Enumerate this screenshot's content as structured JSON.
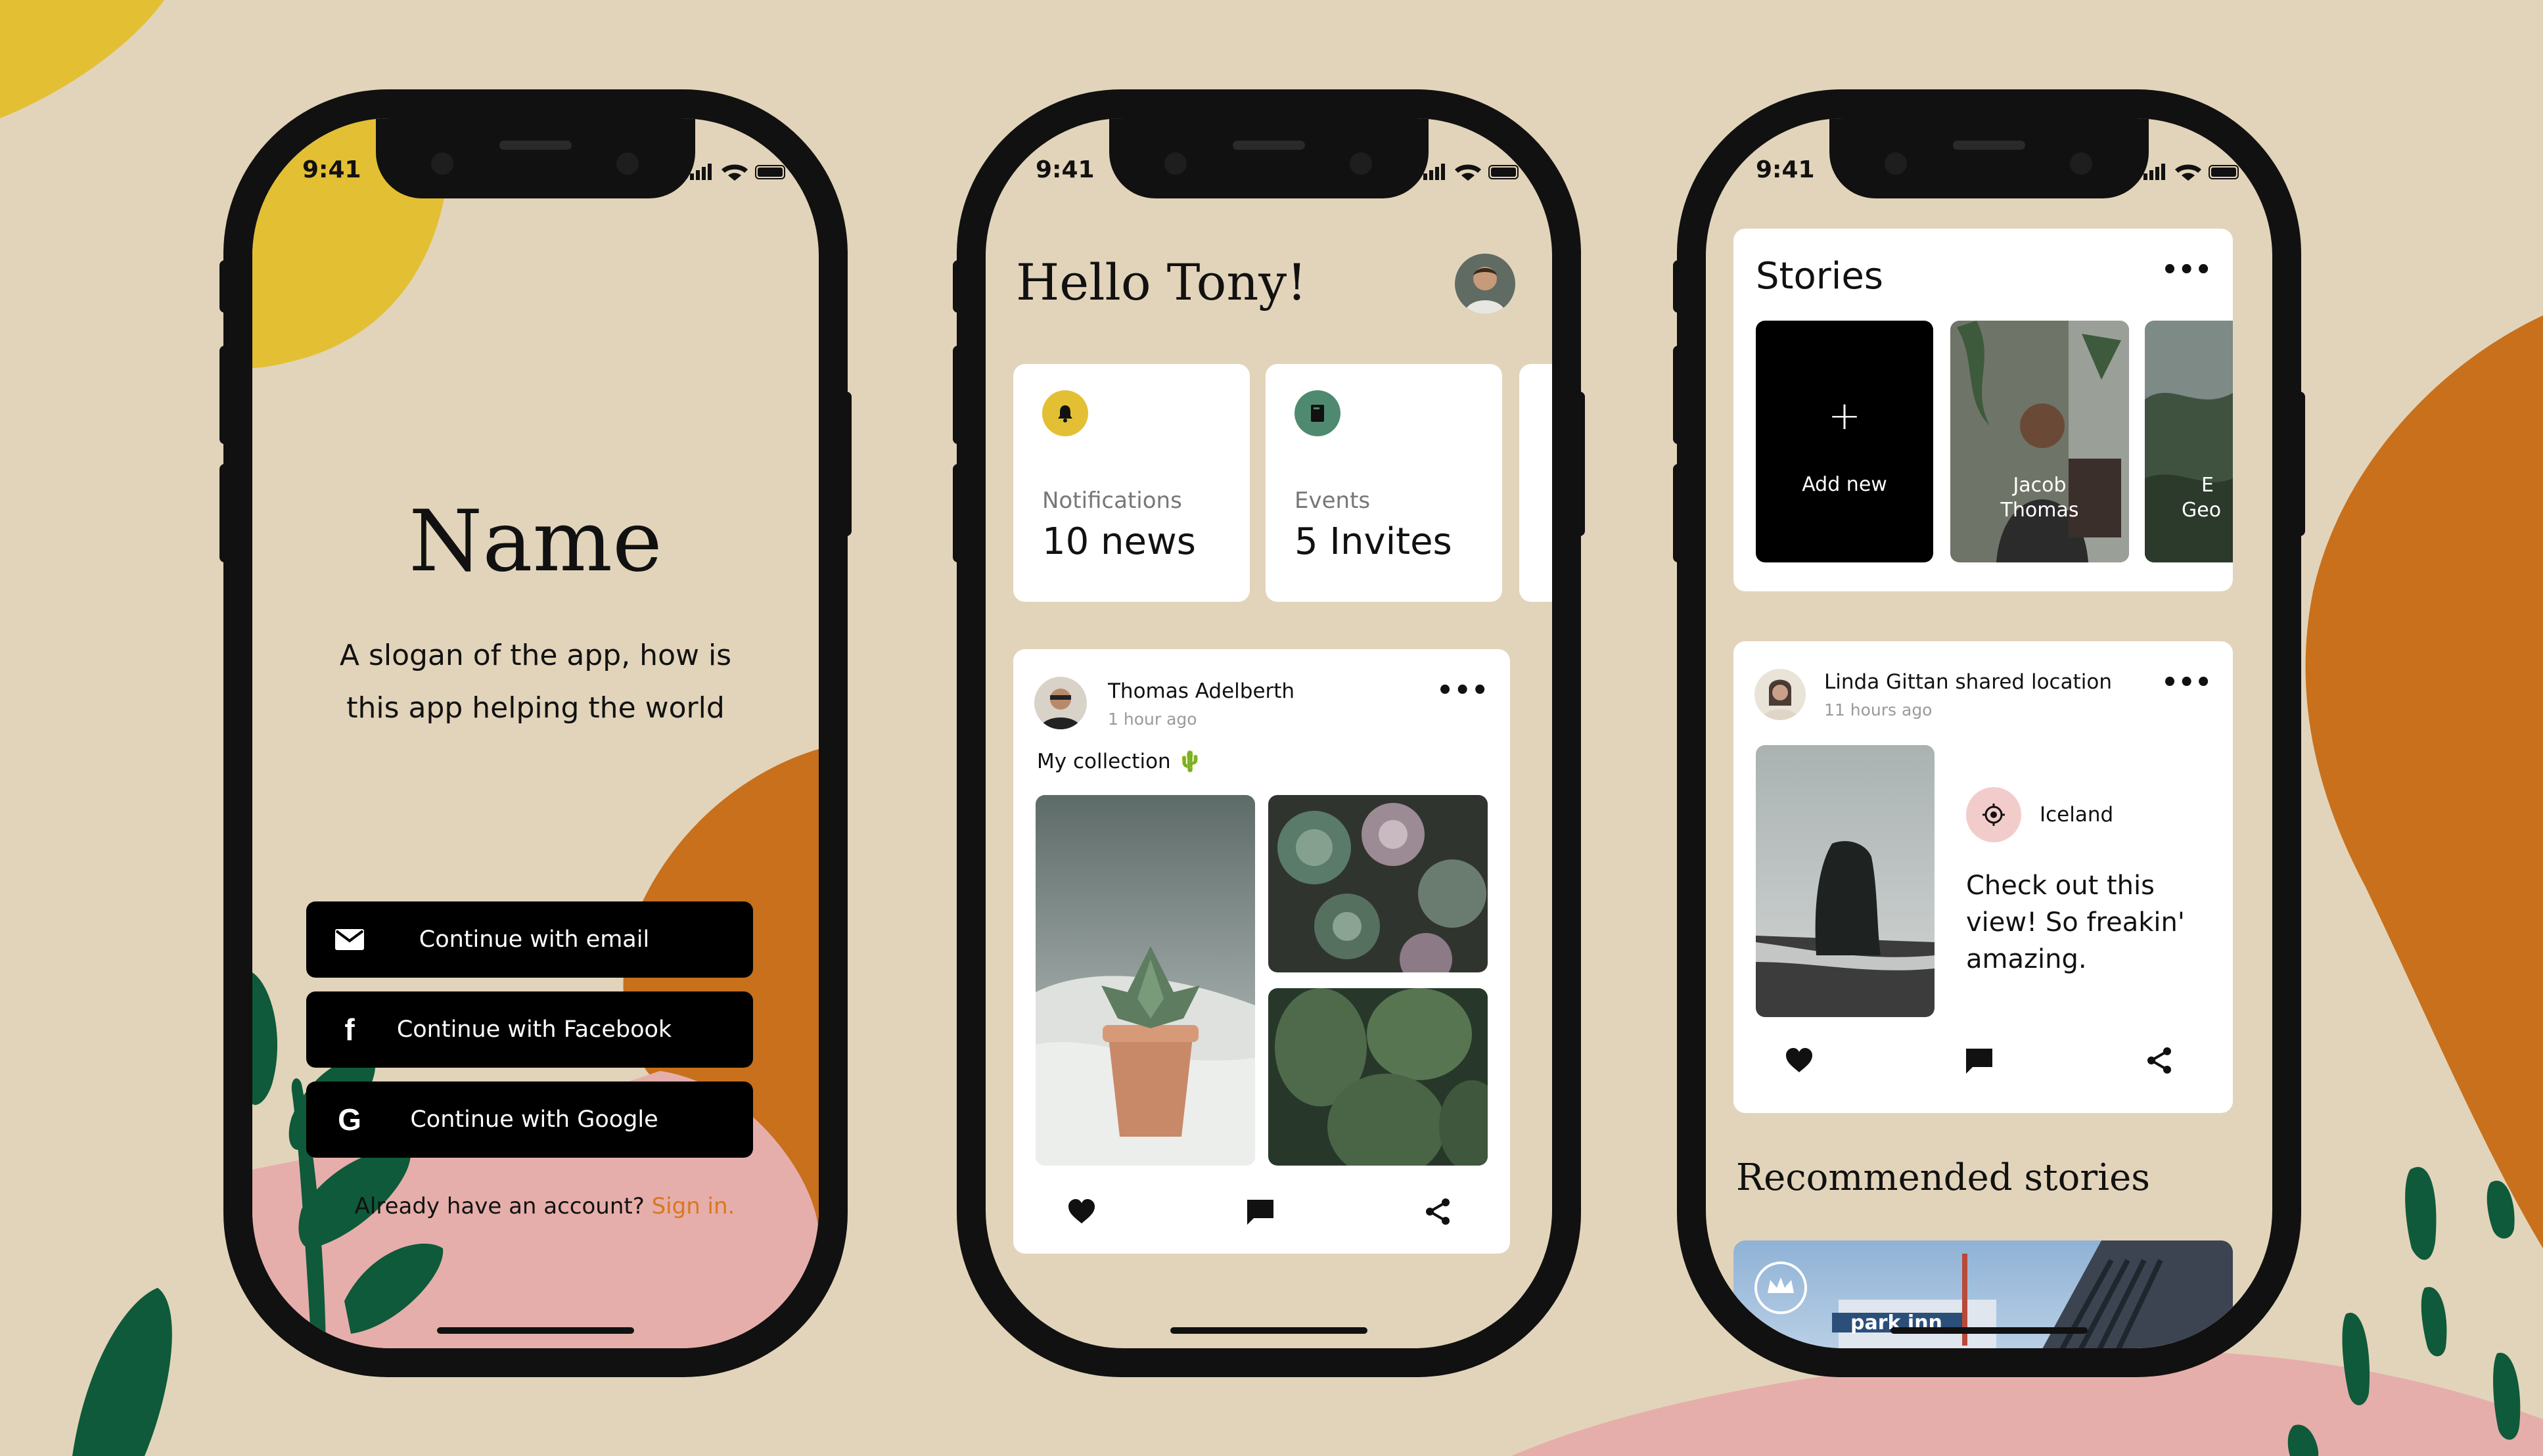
{
  "colors": {
    "background": "#e2d4ba",
    "yellow": "#e3bf34",
    "orange": "#c8701c",
    "pink": "#e6aeaa",
    "green": "#0e5a3a",
    "black": "#000000",
    "white": "#ffffff",
    "link": "#d9781f"
  },
  "status": {
    "time": "9:41"
  },
  "login": {
    "app_name": "Name",
    "slogan_line1": "A slogan of the app, how is",
    "slogan_line2": "this app helping the world",
    "email_button": "Continue with email",
    "facebook_button": "Continue with Facebook",
    "google_button": "Continue with Google",
    "signin_prompt": "Already have an account?",
    "signin_link": "Sign in."
  },
  "feed": {
    "greeting": "Hello Tony!",
    "cards": [
      {
        "label": "Notifications",
        "value": "10 news",
        "icon": "bell-icon"
      },
      {
        "label": "Events",
        "value": "5 Invites",
        "icon": "book-icon"
      }
    ],
    "post": {
      "author": "Thomas Adelberth",
      "time": "1 hour ago",
      "caption": "My collection 🌵"
    }
  },
  "stories": {
    "title": "Stories",
    "add_new": "Add new",
    "people": [
      {
        "name_line1": "Jacob",
        "name_line2": "Thomas"
      },
      {
        "name_line1": "E",
        "name_line2": "Geo"
      }
    ],
    "post": {
      "author_line": "Linda Gittan shared location",
      "time": "11 hours ago",
      "location": "Iceland",
      "message_line1": "Check out this",
      "message_line2": "view! So freakin'",
      "message_line3": "amazing."
    },
    "recommended_title": "Recommended stories",
    "recommended_sign": "park inn"
  }
}
